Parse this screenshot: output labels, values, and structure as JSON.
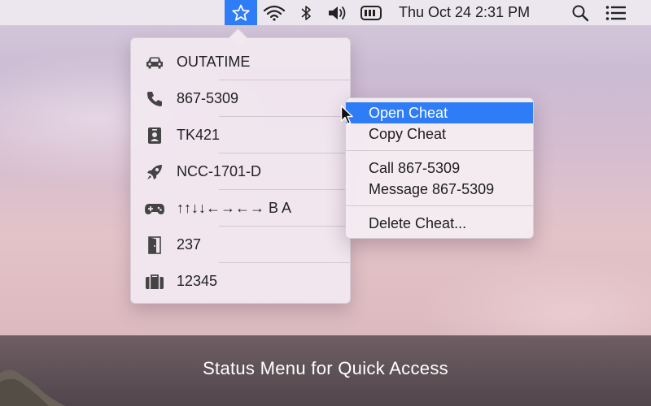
{
  "menubar": {
    "clock": "Thu Oct 24  2:31 PM",
    "icons": [
      "star-icon",
      "wifi-icon",
      "bluetooth-icon",
      "volume-icon",
      "battery-icon",
      "spotlight-search-icon",
      "notification-list-icon"
    ]
  },
  "status_menu": {
    "items": [
      {
        "icon": "car-icon",
        "label": "OUTATIME"
      },
      {
        "icon": "phone-icon",
        "label": "867-5309"
      },
      {
        "icon": "id-badge-icon",
        "label": "TK421"
      },
      {
        "icon": "rocket-icon",
        "label": "NCC-1701-D"
      },
      {
        "icon": "gamepad-icon",
        "label": "↑↑↓↓←→←→ B A"
      },
      {
        "icon": "door-icon",
        "label": "237"
      },
      {
        "icon": "briefcase-icon",
        "label": "12345"
      }
    ]
  },
  "context_menu": {
    "open_cheat": "Open Cheat",
    "copy_cheat": "Copy Cheat",
    "call": "Call 867-5309",
    "message": "Message 867-5309",
    "delete": "Delete Cheat...",
    "active_item": "Open Cheat"
  },
  "caption": "Status Menu for Quick Access",
  "colors": {
    "accent": "#2f7df6",
    "menu_bg": "#f2e8f0",
    "caption_band": "#463c41"
  }
}
